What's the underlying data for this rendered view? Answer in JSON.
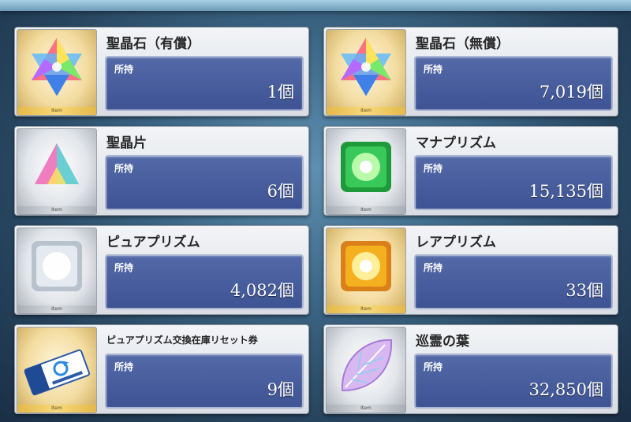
{
  "common": {
    "owned_label": "所持",
    "item_tag": "Item"
  },
  "items": [
    {
      "name": "聖晶石（有償）",
      "count": "1個",
      "icon": "saint-quartz-icon",
      "frame": "gold"
    },
    {
      "name": "聖晶石（無償）",
      "count": "7,019個",
      "icon": "saint-quartz-icon",
      "frame": "gold"
    },
    {
      "name": "聖晶片",
      "count": "6個",
      "icon": "quartz-fragment-icon",
      "frame": "silver"
    },
    {
      "name": "マナプリズム",
      "count": "15,135個",
      "icon": "mana-prism-icon",
      "frame": "silver"
    },
    {
      "name": "ピュアプリズム",
      "count": "4,082個",
      "icon": "pure-prism-icon",
      "frame": "silver"
    },
    {
      "name": "レアプリズム",
      "count": "33個",
      "icon": "rare-prism-icon",
      "frame": "gold"
    },
    {
      "name": "ピュアプリズム交換在庫リセット券",
      "count": "9個",
      "icon": "reset-ticket-icon",
      "frame": "gold"
    },
    {
      "name": "巡霊の葉",
      "count": "32,850個",
      "icon": "spirit-leaf-icon",
      "frame": "silver"
    }
  ],
  "colors": {
    "panel_blue": "#4a5fa0",
    "gold_frame": "#e5b84a",
    "silver_frame": "#c9cdd2"
  }
}
